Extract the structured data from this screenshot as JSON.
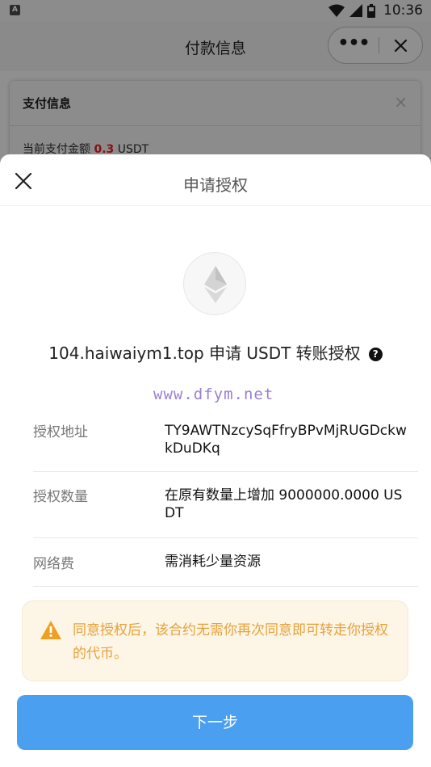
{
  "status_bar": {
    "app_icon_letter": "A",
    "time": "10:36"
  },
  "header": {
    "title": "付款信息",
    "more_label": "•••"
  },
  "payment_card": {
    "title": "支付信息",
    "close_label": "×",
    "amount_prefix": "当前支付金额",
    "amount_value": "0.3",
    "amount_unit": "USDT"
  },
  "sheet": {
    "title": "申请授权",
    "request_text": "104.haiwaiym1.top 申请 USDT 转账授权",
    "help_label": "?",
    "watermark": "www.dfym.net",
    "rows": [
      {
        "label": "授权地址",
        "value": "TY9AWTNzcySqFfryBPvMjRUGDckwkDuDKq"
      },
      {
        "label": "授权数量",
        "value": "在原有数量上增加 9000000.0000 USDT"
      },
      {
        "label": "网络费",
        "value": "需消耗少量资源"
      }
    ],
    "warning_text": "同意授权后，该合约无需你再次同意即可转走你授权的代币。",
    "next_button_label": "下一步"
  },
  "colors": {
    "primary_button": "#4a9ff0",
    "warning_text": "#e6a23c",
    "warning_bg": "#fdf5e6",
    "amount_highlight": "#8a1010"
  }
}
